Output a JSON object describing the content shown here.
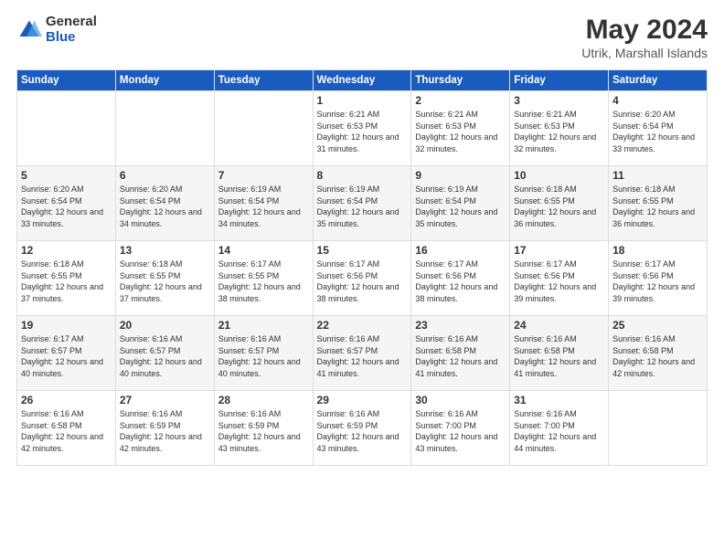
{
  "header": {
    "logo_general": "General",
    "logo_blue": "Blue",
    "title": "May 2024",
    "location": "Utrik, Marshall Islands"
  },
  "days_of_week": [
    "Sunday",
    "Monday",
    "Tuesday",
    "Wednesday",
    "Thursday",
    "Friday",
    "Saturday"
  ],
  "weeks": [
    [
      {
        "day": "",
        "info": ""
      },
      {
        "day": "",
        "info": ""
      },
      {
        "day": "",
        "info": ""
      },
      {
        "day": "1",
        "info": "Sunrise: 6:21 AM\nSunset: 6:53 PM\nDaylight: 12 hours and 31 minutes."
      },
      {
        "day": "2",
        "info": "Sunrise: 6:21 AM\nSunset: 6:53 PM\nDaylight: 12 hours and 32 minutes."
      },
      {
        "day": "3",
        "info": "Sunrise: 6:21 AM\nSunset: 6:53 PM\nDaylight: 12 hours and 32 minutes."
      },
      {
        "day": "4",
        "info": "Sunrise: 6:20 AM\nSunset: 6:54 PM\nDaylight: 12 hours and 33 minutes."
      }
    ],
    [
      {
        "day": "5",
        "info": "Sunrise: 6:20 AM\nSunset: 6:54 PM\nDaylight: 12 hours and 33 minutes."
      },
      {
        "day": "6",
        "info": "Sunrise: 6:20 AM\nSunset: 6:54 PM\nDaylight: 12 hours and 34 minutes."
      },
      {
        "day": "7",
        "info": "Sunrise: 6:19 AM\nSunset: 6:54 PM\nDaylight: 12 hours and 34 minutes."
      },
      {
        "day": "8",
        "info": "Sunrise: 6:19 AM\nSunset: 6:54 PM\nDaylight: 12 hours and 35 minutes."
      },
      {
        "day": "9",
        "info": "Sunrise: 6:19 AM\nSunset: 6:54 PM\nDaylight: 12 hours and 35 minutes."
      },
      {
        "day": "10",
        "info": "Sunrise: 6:18 AM\nSunset: 6:55 PM\nDaylight: 12 hours and 36 minutes."
      },
      {
        "day": "11",
        "info": "Sunrise: 6:18 AM\nSunset: 6:55 PM\nDaylight: 12 hours and 36 minutes."
      }
    ],
    [
      {
        "day": "12",
        "info": "Sunrise: 6:18 AM\nSunset: 6:55 PM\nDaylight: 12 hours and 37 minutes."
      },
      {
        "day": "13",
        "info": "Sunrise: 6:18 AM\nSunset: 6:55 PM\nDaylight: 12 hours and 37 minutes."
      },
      {
        "day": "14",
        "info": "Sunrise: 6:17 AM\nSunset: 6:55 PM\nDaylight: 12 hours and 38 minutes."
      },
      {
        "day": "15",
        "info": "Sunrise: 6:17 AM\nSunset: 6:56 PM\nDaylight: 12 hours and 38 minutes."
      },
      {
        "day": "16",
        "info": "Sunrise: 6:17 AM\nSunset: 6:56 PM\nDaylight: 12 hours and 38 minutes."
      },
      {
        "day": "17",
        "info": "Sunrise: 6:17 AM\nSunset: 6:56 PM\nDaylight: 12 hours and 39 minutes."
      },
      {
        "day": "18",
        "info": "Sunrise: 6:17 AM\nSunset: 6:56 PM\nDaylight: 12 hours and 39 minutes."
      }
    ],
    [
      {
        "day": "19",
        "info": "Sunrise: 6:17 AM\nSunset: 6:57 PM\nDaylight: 12 hours and 40 minutes."
      },
      {
        "day": "20",
        "info": "Sunrise: 6:16 AM\nSunset: 6:57 PM\nDaylight: 12 hours and 40 minutes."
      },
      {
        "day": "21",
        "info": "Sunrise: 6:16 AM\nSunset: 6:57 PM\nDaylight: 12 hours and 40 minutes."
      },
      {
        "day": "22",
        "info": "Sunrise: 6:16 AM\nSunset: 6:57 PM\nDaylight: 12 hours and 41 minutes."
      },
      {
        "day": "23",
        "info": "Sunrise: 6:16 AM\nSunset: 6:58 PM\nDaylight: 12 hours and 41 minutes."
      },
      {
        "day": "24",
        "info": "Sunrise: 6:16 AM\nSunset: 6:58 PM\nDaylight: 12 hours and 41 minutes."
      },
      {
        "day": "25",
        "info": "Sunrise: 6:16 AM\nSunset: 6:58 PM\nDaylight: 12 hours and 42 minutes."
      }
    ],
    [
      {
        "day": "26",
        "info": "Sunrise: 6:16 AM\nSunset: 6:58 PM\nDaylight: 12 hours and 42 minutes."
      },
      {
        "day": "27",
        "info": "Sunrise: 6:16 AM\nSunset: 6:59 PM\nDaylight: 12 hours and 42 minutes."
      },
      {
        "day": "28",
        "info": "Sunrise: 6:16 AM\nSunset: 6:59 PM\nDaylight: 12 hours and 43 minutes."
      },
      {
        "day": "29",
        "info": "Sunrise: 6:16 AM\nSunset: 6:59 PM\nDaylight: 12 hours and 43 minutes."
      },
      {
        "day": "30",
        "info": "Sunrise: 6:16 AM\nSunset: 7:00 PM\nDaylight: 12 hours and 43 minutes."
      },
      {
        "day": "31",
        "info": "Sunrise: 6:16 AM\nSunset: 7:00 PM\nDaylight: 12 hours and 44 minutes."
      },
      {
        "day": "",
        "info": ""
      }
    ]
  ]
}
